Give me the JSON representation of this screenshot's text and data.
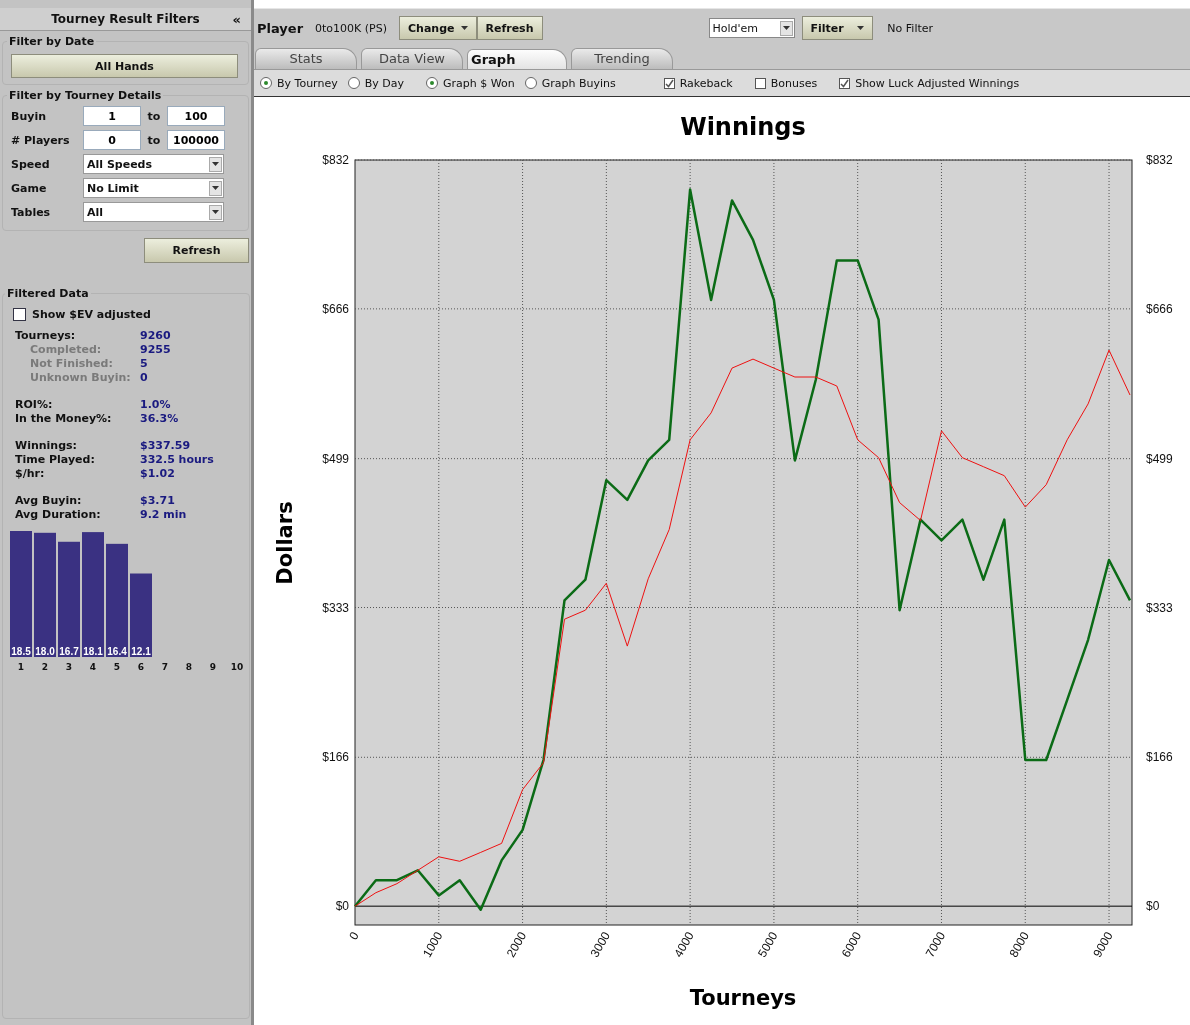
{
  "sidebar": {
    "title": "Tourney Result Filters",
    "collapse": "«",
    "date_filter": {
      "legend": "Filter by Date",
      "button": "All Hands"
    },
    "details": {
      "legend": "Filter by Tourney Details",
      "rows": [
        {
          "kind": "range",
          "label": "Buyin",
          "from": "1",
          "to_label": "to",
          "to": "100"
        },
        {
          "kind": "range",
          "label": "# Players",
          "from": "0",
          "to_label": "to",
          "to": "100000"
        },
        {
          "kind": "select",
          "label": "Speed",
          "value": "All Speeds"
        },
        {
          "kind": "select",
          "label": "Game",
          "value": "No Limit"
        },
        {
          "kind": "select",
          "label": "Tables",
          "value": "All"
        }
      ],
      "refresh": "Refresh"
    },
    "filtered": {
      "legend": "Filtered Data",
      "ev_checkbox": {
        "label": "Show $EV adjusted",
        "checked": false
      },
      "groups": [
        {
          "rows": [
            {
              "kind": "main",
              "label": "Tourneys:",
              "value": "9260"
            },
            {
              "kind": "sub",
              "label": "Completed:",
              "value": "9255"
            },
            {
              "kind": "sub",
              "label": "Not Finished:",
              "value": "5"
            },
            {
              "kind": "sub",
              "label": "Unknown Buyin:",
              "value": "0"
            }
          ]
        },
        {
          "rows": [
            {
              "kind": "main",
              "label": "ROI%:",
              "value": "1.0%"
            },
            {
              "kind": "main",
              "label": "In the Money%:",
              "value": "36.3%"
            }
          ]
        },
        {
          "rows": [
            {
              "kind": "main",
              "label": "Winnings:",
              "value": "$337.59"
            },
            {
              "kind": "main",
              "label": "Time Played:",
              "value": "332.5 hours"
            },
            {
              "kind": "main",
              "label": "$/hr:",
              "value": "$1.02"
            }
          ]
        },
        {
          "rows": [
            {
              "kind": "main",
              "label": "Avg Buyin:",
              "value": "$3.71"
            },
            {
              "kind": "main",
              "label": "Avg Duration:",
              "value": "9.2 min"
            }
          ]
        }
      ],
      "chart_data": {
        "type": "bar",
        "categories": [
          "1",
          "2",
          "3",
          "4",
          "5",
          "6",
          "7",
          "8",
          "9",
          "10"
        ],
        "series": [
          {
            "color": "#3a3182",
            "values": [
              18.5,
              18.0,
              16.7,
              18.1,
              16.4,
              12.1,
              null,
              null,
              null,
              null
            ],
            "value_labels": [
              "18.5",
              "18.0",
              "16.7",
              "18.1",
              "16.4",
              "12.1",
              null,
              null,
              null,
              null
            ]
          }
        ],
        "data_labels": true
      }
    }
  },
  "toolbar": {
    "player_label": "Player",
    "player": "0to100K (PS)",
    "change": "Change",
    "refresh": "Refresh",
    "game": "Hold'em",
    "filter": "Filter",
    "filter_status": "No Filter"
  },
  "tabs": [
    {
      "label": "Stats",
      "selected": false
    },
    {
      "label": "Data View",
      "selected": false
    },
    {
      "label": "Graph",
      "selected": true
    },
    {
      "label": "Trending",
      "selected": false
    }
  ],
  "options": {
    "mode_radios": [
      {
        "label": "By Tourney",
        "selected": true
      },
      {
        "label": "By Day",
        "selected": false
      }
    ],
    "graph_radios": [
      {
        "label": "Graph $ Won",
        "selected": true
      },
      {
        "label": "Graph Buyins",
        "selected": false
      }
    ],
    "checkboxes": [
      {
        "label": "Rakeback",
        "checked": true
      },
      {
        "label": "Bonuses",
        "checked": false
      },
      {
        "label": "Show Luck Adjusted Winnings",
        "checked": true
      }
    ]
  },
  "chart": {
    "chart_data": {
      "type": "line",
      "title": "Winnings",
      "xlabel": "Tourneys",
      "ylabel": "Dollars",
      "x": [
        0,
        250,
        500,
        750,
        1000,
        1250,
        1500,
        1750,
        2000,
        2250,
        2500,
        2750,
        3000,
        3250,
        3500,
        3750,
        4000,
        4250,
        4500,
        4750,
        5000,
        5250,
        5500,
        5750,
        6000,
        6250,
        6500,
        6750,
        7000,
        7250,
        7500,
        7750,
        8000,
        8250,
        8500,
        8750,
        9000,
        9250
      ],
      "series": [
        {
          "color": "#0b6b16",
          "values": [
            0,
            29,
            29,
            40,
            12,
            29,
            -4,
            51,
            85,
            163,
            341,
            364,
            475,
            453,
            497,
            520,
            799,
            676,
            787,
            743,
            676,
            497,
            587,
            720,
            720,
            654,
            330,
            431,
            408,
            431,
            364,
            431,
            163,
            163,
            230,
            297,
            386,
            341
          ]
        },
        {
          "color": "#ee1111",
          "values": [
            0,
            15,
            25,
            40,
            55,
            50,
            60,
            70,
            130,
            160,
            320,
            330,
            360,
            290,
            365,
            420,
            520,
            550,
            600,
            610,
            600,
            590,
            590,
            580,
            520,
            500,
            450,
            430,
            530,
            500,
            490,
            480,
            445,
            470,
            520,
            560,
            620,
            570
          ]
        }
      ],
      "xlim": [
        0,
        9274
      ],
      "ylim": [
        -21,
        832
      ],
      "grid": true,
      "xticks": [
        0,
        1000,
        2000,
        3000,
        4000,
        5000,
        6000,
        7000,
        8000,
        9000
      ],
      "yticks": [
        {
          "value": 0,
          "label": "$0"
        },
        {
          "value": 166,
          "label": "$166"
        },
        {
          "value": 333,
          "label": "$333"
        },
        {
          "value": 499,
          "label": "$499"
        },
        {
          "value": 666,
          "label": "$666"
        },
        {
          "value": 832,
          "label": "$832"
        }
      ]
    }
  }
}
